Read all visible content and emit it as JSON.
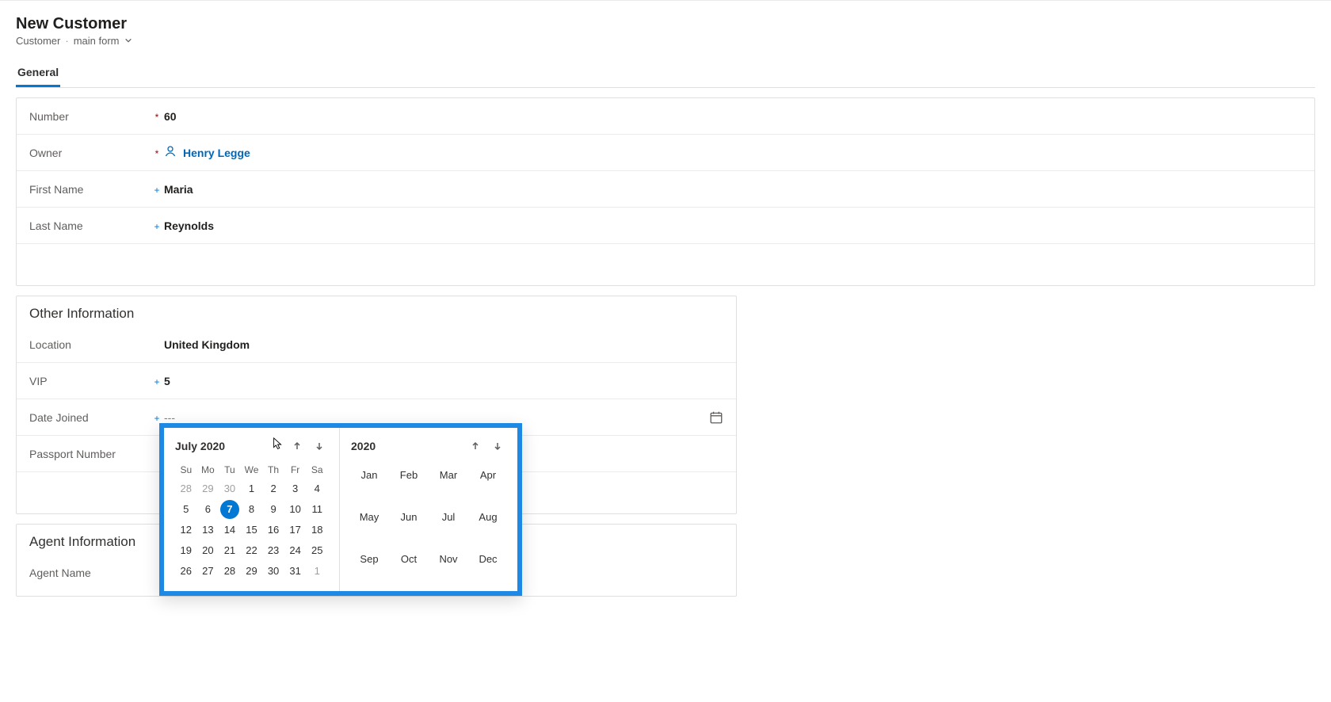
{
  "header": {
    "title": "New Customer",
    "entity": "Customer",
    "formName": "main form"
  },
  "tabs": {
    "general": "General"
  },
  "fields": {
    "number": {
      "label": "Number",
      "value": "60"
    },
    "owner": {
      "label": "Owner",
      "value": "Henry Legge"
    },
    "firstName": {
      "label": "First Name",
      "value": "Maria"
    },
    "lastName": {
      "label": "Last Name",
      "value": "Reynolds"
    }
  },
  "other": {
    "title": "Other Information",
    "location": {
      "label": "Location",
      "value": "United Kingdom"
    },
    "vip": {
      "label": "VIP",
      "value": "5"
    },
    "dateJoined": {
      "label": "Date Joined",
      "value": "---"
    },
    "passportNumber": {
      "label": "Passport Number",
      "value": "---"
    }
  },
  "agent": {
    "title": "Agent Information",
    "agentName": {
      "label": "Agent Name",
      "value": ""
    }
  },
  "calendar": {
    "monthTitle": "July 2020",
    "yearTitle": "2020",
    "dow": [
      "Su",
      "Mo",
      "Tu",
      "We",
      "Th",
      "Fr",
      "Sa"
    ],
    "weeks": [
      [
        {
          "d": "28",
          "m": true
        },
        {
          "d": "29",
          "m": true
        },
        {
          "d": "30",
          "m": true
        },
        {
          "d": "1"
        },
        {
          "d": "2"
        },
        {
          "d": "3"
        },
        {
          "d": "4"
        }
      ],
      [
        {
          "d": "5"
        },
        {
          "d": "6"
        },
        {
          "d": "7",
          "sel": true
        },
        {
          "d": "8"
        },
        {
          "d": "9"
        },
        {
          "d": "10"
        },
        {
          "d": "11"
        }
      ],
      [
        {
          "d": "12"
        },
        {
          "d": "13"
        },
        {
          "d": "14"
        },
        {
          "d": "15"
        },
        {
          "d": "16"
        },
        {
          "d": "17"
        },
        {
          "d": "18"
        }
      ],
      [
        {
          "d": "19"
        },
        {
          "d": "20"
        },
        {
          "d": "21"
        },
        {
          "d": "22"
        },
        {
          "d": "23"
        },
        {
          "d": "24"
        },
        {
          "d": "25"
        }
      ],
      [
        {
          "d": "26"
        },
        {
          "d": "27"
        },
        {
          "d": "28"
        },
        {
          "d": "29"
        },
        {
          "d": "30"
        },
        {
          "d": "31"
        },
        {
          "d": "1",
          "m": true
        }
      ]
    ],
    "months": [
      "Jan",
      "Feb",
      "Mar",
      "Apr",
      "May",
      "Jun",
      "Jul",
      "Aug",
      "Sep",
      "Oct",
      "Nov",
      "Dec"
    ]
  }
}
